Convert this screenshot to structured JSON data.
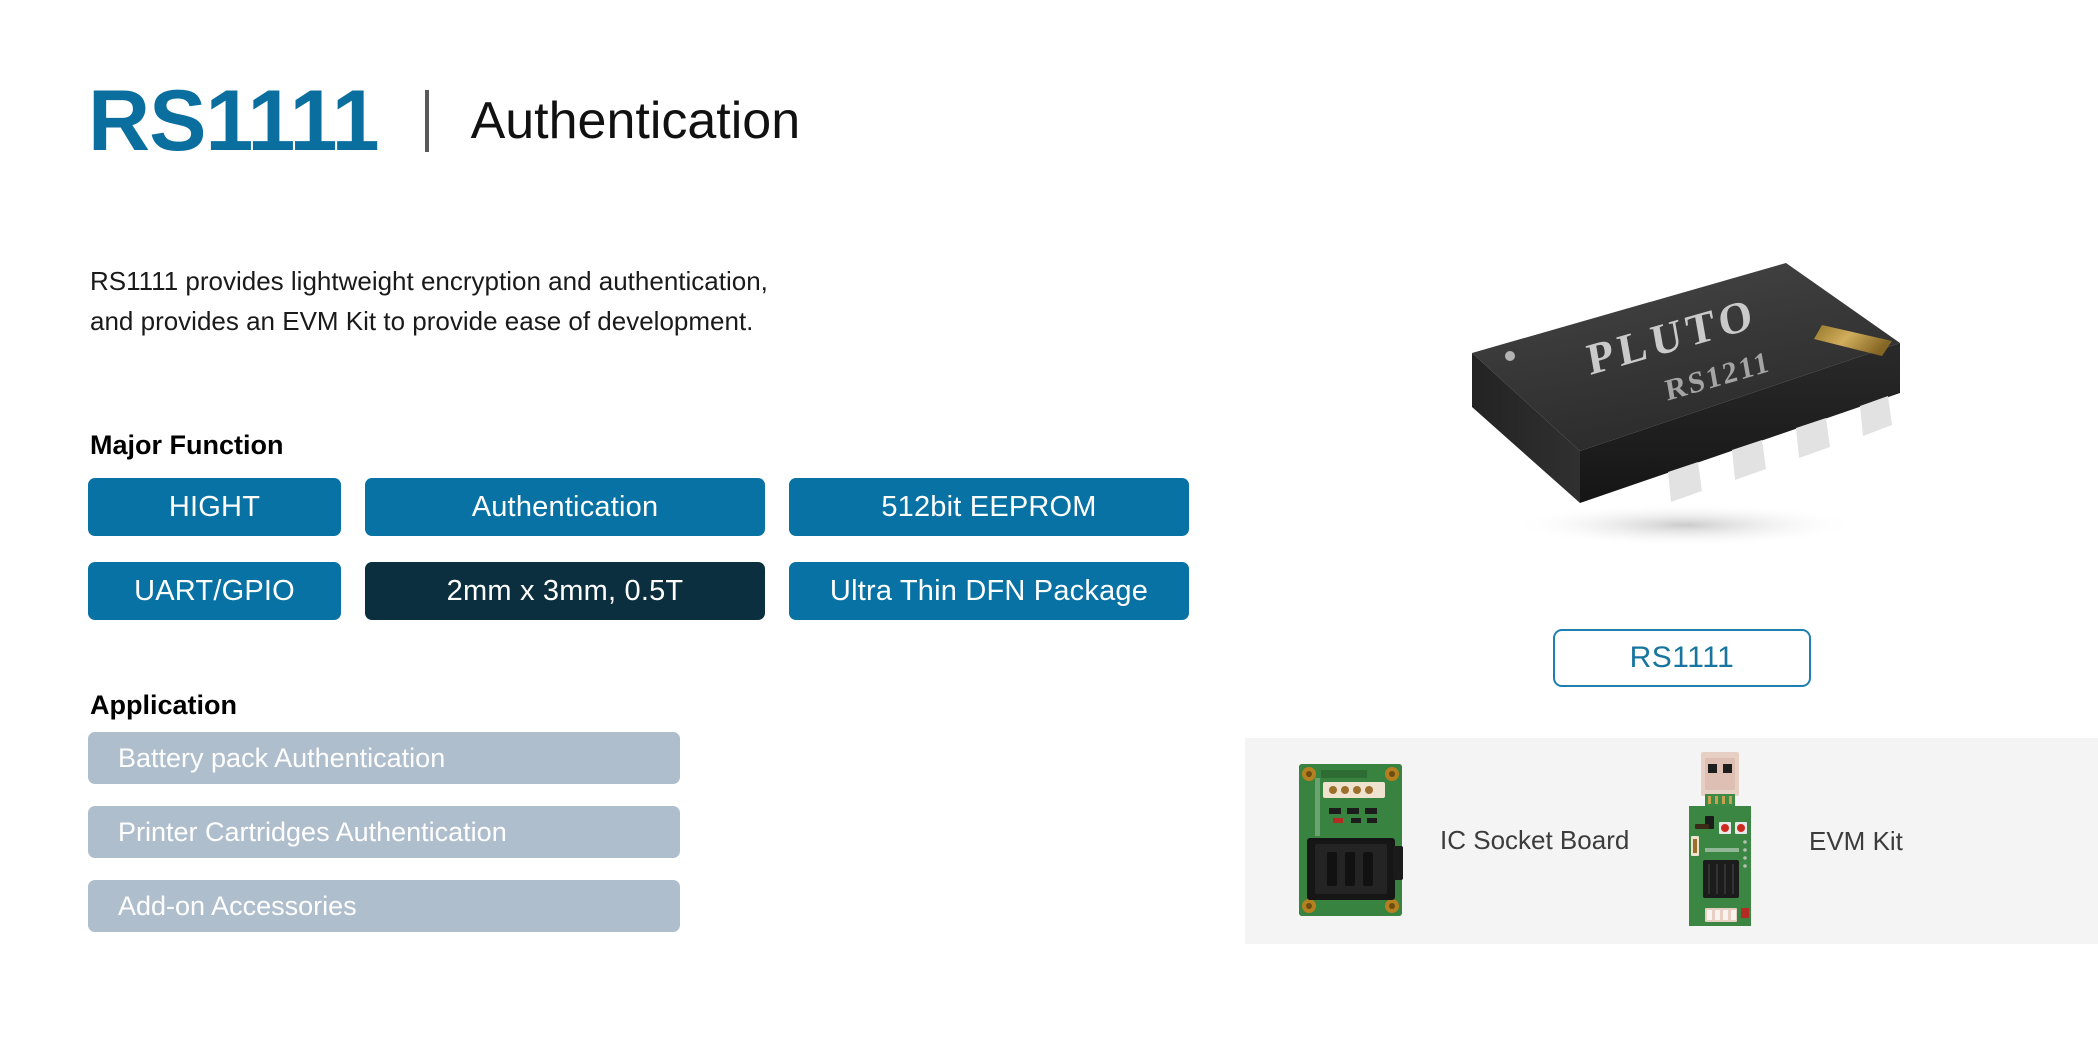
{
  "header": {
    "part_number": "RS1111",
    "category": "Authentication"
  },
  "description": {
    "line1": "RS1111 provides lightweight encryption and authentication,",
    "line2": "and provides an EVM Kit to provide ease of development."
  },
  "major_function": {
    "title": "Major Function",
    "items": [
      {
        "label": "HIGHT",
        "style": "primary"
      },
      {
        "label": "Authentication",
        "style": "primary"
      },
      {
        "label": "512bit EEPROM",
        "style": "primary"
      },
      {
        "label": "UART/GPIO",
        "style": "primary"
      },
      {
        "label": "2mm x 3mm, 0.5T",
        "style": "dark"
      },
      {
        "label": "Ultra Thin DFN Package",
        "style": "primary"
      }
    ]
  },
  "application": {
    "title": "Application",
    "items": [
      {
        "label": "Battery pack Authentication"
      },
      {
        "label": "Printer Cartridges Authentication"
      },
      {
        "label": "Add-on Accessories"
      }
    ]
  },
  "product_image": {
    "package_marking_brand": "PLUTO",
    "package_marking_part": "RS1211",
    "caption": "RS1111"
  },
  "boards": {
    "socket": {
      "caption": "IC Socket Board"
    },
    "evm": {
      "caption": "EVM Kit"
    }
  },
  "colors": {
    "brand_teal": "#0A6F9E",
    "chip_primary": "#0872A4",
    "chip_dark": "#0B2F3F",
    "application_bg": "#AFBECD",
    "panel_bg": "#F4F4F4",
    "label_border": "#1F7FB0"
  }
}
